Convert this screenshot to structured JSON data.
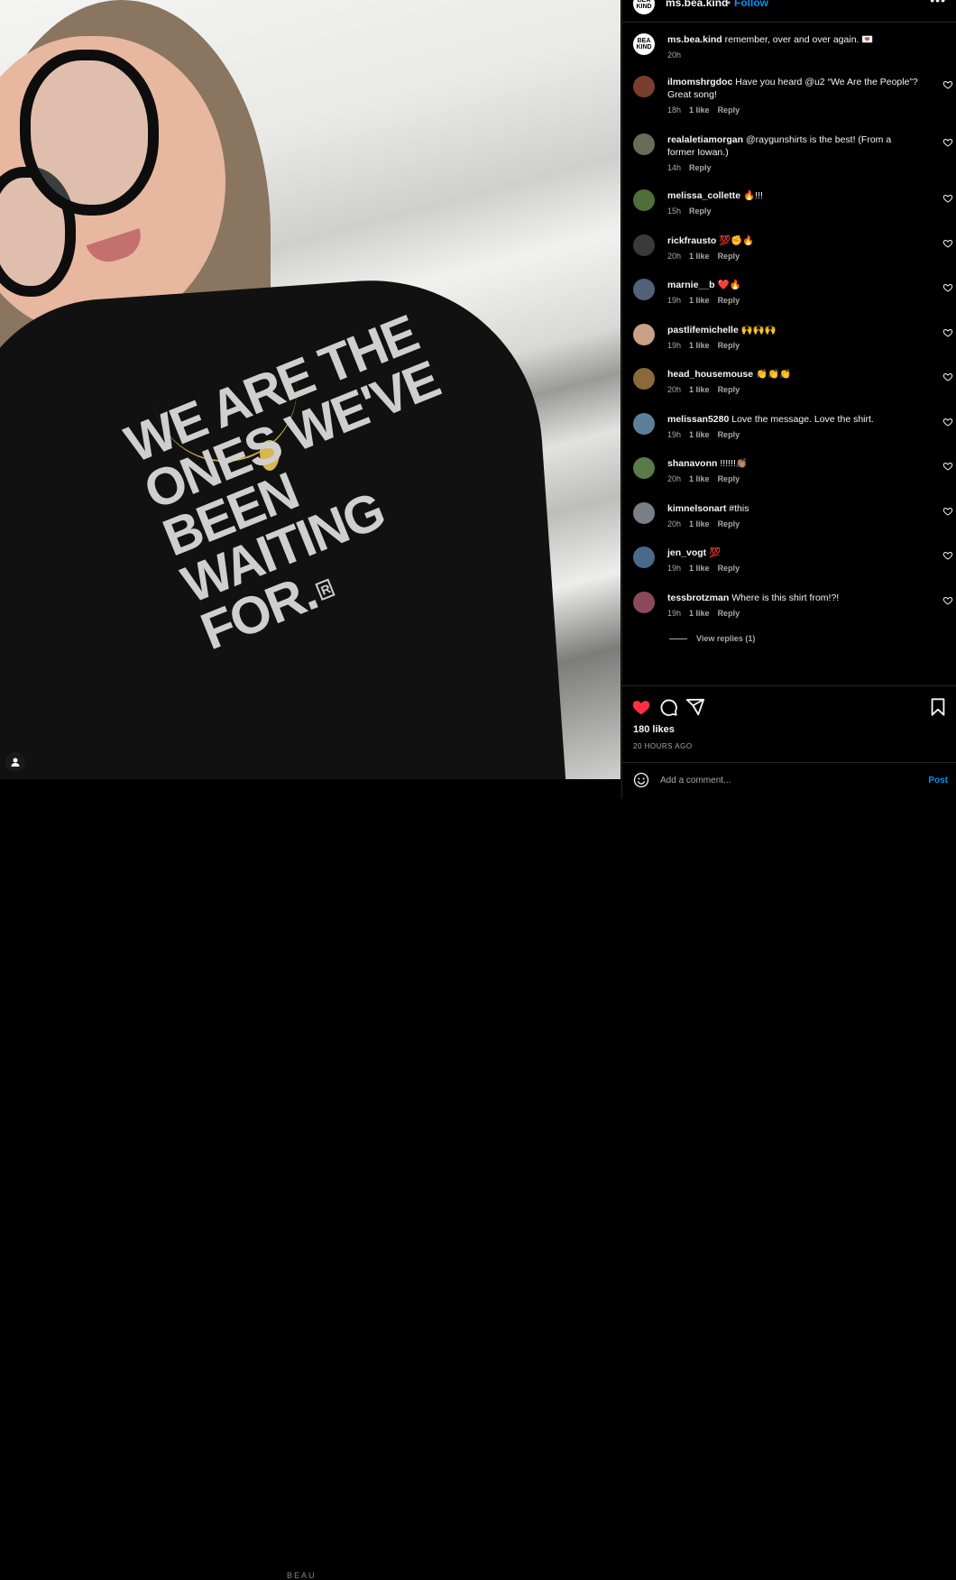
{
  "post": {
    "shirt_text": [
      "WE ARE THE",
      "ONES WE'VE",
      "BEEN",
      "WAITING",
      "FOR."
    ],
    "shirt_mark": "R",
    "bottom_label": "BEAU"
  },
  "header": {
    "logo_text": "BEA KIND",
    "username": "ms.bea.kind",
    "separator": "•",
    "follow": "Follow",
    "more": "•••"
  },
  "caption": {
    "username": "ms.bea.kind",
    "text": "remember, over and over again. 💌",
    "time": "20h",
    "logo_text": "BEA KIND"
  },
  "comments": [
    {
      "username": "ilmomshrgdoc",
      "text": "Have you heard @u2 “We Are the People”? Great song!",
      "time": "18h",
      "likes": "1 like",
      "reply": "Reply",
      "avatar": "#7a3f2c"
    },
    {
      "username": "realaletiamorgan",
      "text": "@raygunshirts is the best! (From a former Iowan.)",
      "time": "14h",
      "likes": "",
      "reply": "Reply",
      "avatar": "#6b6b5a"
    },
    {
      "username": "melissa_collette",
      "text": "🔥!!!",
      "time": "15h",
      "likes": "",
      "reply": "Reply",
      "avatar": "#4f6e3a"
    },
    {
      "username": "rickfrausto",
      "text": "💯✊🔥",
      "time": "20h",
      "likes": "1 like",
      "reply": "Reply",
      "avatar": "#3a3a3a"
    },
    {
      "username": "marnie__b",
      "text": "❤️🔥",
      "time": "19h",
      "likes": "1 like",
      "reply": "Reply",
      "avatar": "#52607a"
    },
    {
      "username": "pastlifemichelle",
      "text": "🙌🙌🙌",
      "time": "19h",
      "likes": "1 like",
      "reply": "Reply",
      "avatar": "#c9a088"
    },
    {
      "username": "head_housemouse",
      "text": "👏👏👏",
      "time": "20h",
      "likes": "1 like",
      "reply": "Reply",
      "avatar": "#8a6a3a"
    },
    {
      "username": "melissan5280",
      "text": "Love the message. Love the shirt.",
      "time": "19h",
      "likes": "1 like",
      "reply": "Reply",
      "avatar": "#5e7f9a"
    },
    {
      "username": "shanavonn",
      "text": "!!!!!!👏🏽",
      "time": "20h",
      "likes": "1 like",
      "reply": "Reply",
      "avatar": "#5a7a4a"
    },
    {
      "username": "kimnelsonart",
      "text": "#this",
      "time": "20h",
      "likes": "1 like",
      "reply": "Reply",
      "avatar": "#7a7e86"
    },
    {
      "username": "jen_vogt",
      "text": "💯",
      "time": "19h",
      "likes": "1 like",
      "reply": "Reply",
      "avatar": "#4a6a8a"
    },
    {
      "username": "tessbrotzman",
      "text": "Where is this shirt from!?!",
      "time": "19h",
      "likes": "1 like",
      "reply": "Reply",
      "avatar": "#8a4a5a"
    }
  ],
  "view_replies": "View replies (1)",
  "likes": "180 likes",
  "date": "20 HOURS AGO",
  "add_comment": {
    "placeholder": "Add a comment...",
    "post": "Post"
  },
  "colors": {
    "accent": "#0095f6",
    "heart": "#ff3040",
    "background": "#000000"
  }
}
